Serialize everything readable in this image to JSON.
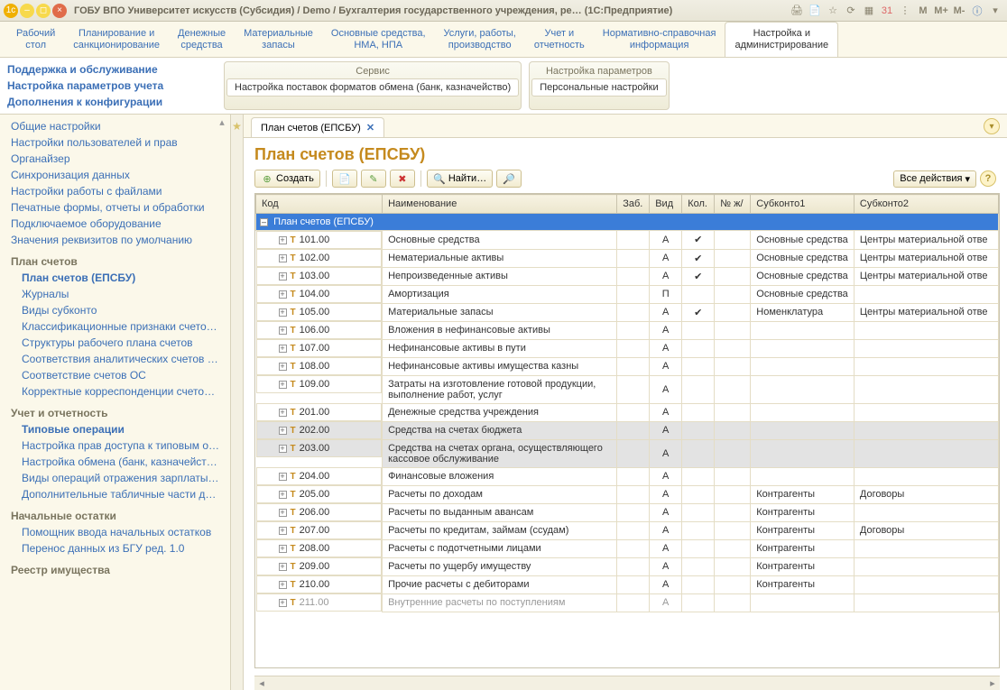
{
  "titlebar": {
    "text": "ГОБУ ВПО Университет искусств (Субсидия) / Demo / Бухгалтерия государственного учреждения, ре…   (1С:Предприятие)",
    "m_buttons": [
      "M",
      "M+",
      "M-"
    ]
  },
  "topnav": [
    {
      "l1": "Рабочий",
      "l2": "стол"
    },
    {
      "l1": "Планирование и",
      "l2": "санкционирование"
    },
    {
      "l1": "Денежные",
      "l2": "средства"
    },
    {
      "l1": "Материальные",
      "l2": "запасы"
    },
    {
      "l1": "Основные средства,",
      "l2": "НМА, НПА"
    },
    {
      "l1": "Услуги, работы,",
      "l2": "производство"
    },
    {
      "l1": "Учет и",
      "l2": "отчетность"
    },
    {
      "l1": "Нормативно-справочная",
      "l2": "информация"
    },
    {
      "l1": "Настройка и",
      "l2": "администрирование",
      "active": true
    }
  ],
  "sidebar_top": [
    "Поддержка и обслуживание",
    "Настройка параметров учета",
    "Дополнения к конфигурации"
  ],
  "ribbon": {
    "g1": {
      "hdr": "Сервис",
      "row": "Настройка поставок форматов обмена (банк, казначейство)"
    },
    "g2": {
      "hdr": "Настройка параметров",
      "row": "Персональные настройки"
    }
  },
  "content_tab": {
    "label": "План счетов (ЕПСБУ)"
  },
  "page_title": "План счетов (ЕПСБУ)",
  "toolbar": {
    "create": "Создать",
    "find": "Найти…",
    "all_actions": "Все действия"
  },
  "sidebar": [
    {
      "type": "link",
      "text": "Общие настройки"
    },
    {
      "type": "link",
      "text": "Настройки пользователей и прав"
    },
    {
      "type": "link",
      "text": "Органайзер"
    },
    {
      "type": "link",
      "text": "Синхронизация данных"
    },
    {
      "type": "link",
      "text": "Настройки работы с файлами"
    },
    {
      "type": "link",
      "text": "Печатные формы, отчеты и обработки"
    },
    {
      "type": "link",
      "text": "Подключаемое оборудование"
    },
    {
      "type": "link",
      "text": "Значения реквизитов по умолчанию"
    },
    {
      "type": "title",
      "text": "План счетов"
    },
    {
      "type": "link",
      "text": "План счетов (ЕПСБУ)",
      "indent": true,
      "bold": true
    },
    {
      "type": "link",
      "text": "Журналы",
      "indent": true
    },
    {
      "type": "link",
      "text": "Виды субконто",
      "indent": true
    },
    {
      "type": "link",
      "text": "Классификационные признаки счето…",
      "indent": true
    },
    {
      "type": "link",
      "text": "Структуры рабочего плана счетов",
      "indent": true
    },
    {
      "type": "link",
      "text": "Соответствия аналитических счетов …",
      "indent": true
    },
    {
      "type": "link",
      "text": "Соответствие счетов ОС",
      "indent": true
    },
    {
      "type": "link",
      "text": "Корректные корреспонденции счетов…",
      "indent": true
    },
    {
      "type": "title",
      "text": "Учет и отчетность"
    },
    {
      "type": "link",
      "text": "Типовые операции",
      "indent": true,
      "bold": true
    },
    {
      "type": "link",
      "text": "Настройка прав доступа к типовым о…",
      "indent": true
    },
    {
      "type": "link",
      "text": "Настройка обмена (банк, казначейст…",
      "indent": true
    },
    {
      "type": "link",
      "text": "Виды операций отражения зарплаты …",
      "indent": true
    },
    {
      "type": "link",
      "text": "Дополнительные табличные части до…",
      "indent": true
    },
    {
      "type": "title",
      "text": "Начальные остатки"
    },
    {
      "type": "link",
      "text": "Помощник ввода начальных остатков",
      "indent": true
    },
    {
      "type": "link",
      "text": "Перенос данных из БГУ ред. 1.0",
      "indent": true
    },
    {
      "type": "title",
      "text": "Реестр имущества"
    }
  ],
  "columns": [
    "Код",
    "Наименование",
    "Заб.",
    "Вид",
    "Кол.",
    "№ ж/",
    "Субконто1",
    "Субконто2"
  ],
  "root_row": "План счетов (ЕПСБУ)",
  "rows": [
    {
      "code": "101.00",
      "name": "Основные средства",
      "vid": "А",
      "kol": "✔",
      "s1": "Основные средства",
      "s2": "Центры материальной отве"
    },
    {
      "code": "102.00",
      "name": "Нематериальные активы",
      "vid": "А",
      "kol": "✔",
      "s1": "Основные средства",
      "s2": "Центры материальной отве"
    },
    {
      "code": "103.00",
      "name": "Непроизведенные активы",
      "vid": "А",
      "kol": "✔",
      "s1": "Основные средства",
      "s2": "Центры материальной отве"
    },
    {
      "code": "104.00",
      "name": "Амортизация",
      "vid": "П",
      "kol": "",
      "s1": "Основные средства",
      "s2": ""
    },
    {
      "code": "105.00",
      "name": "Материальные запасы",
      "vid": "А",
      "kol": "✔",
      "s1": "Номенклатура",
      "s2": "Центры материальной отве"
    },
    {
      "code": "106.00",
      "name": "Вложения в нефинансовые активы",
      "vid": "А",
      "kol": "",
      "s1": "",
      "s2": ""
    },
    {
      "code": "107.00",
      "name": "Нефинансовые активы в пути",
      "vid": "А",
      "kol": "",
      "s1": "",
      "s2": ""
    },
    {
      "code": "108.00",
      "name": "Нефинансовые активы имущества казны",
      "vid": "А",
      "kol": "",
      "s1": "",
      "s2": ""
    },
    {
      "code": "109.00",
      "name": "Затраты на изготовление готовой продукции, выполнение работ, услуг",
      "vid": "А",
      "kol": "",
      "s1": "",
      "s2": ""
    },
    {
      "code": "201.00",
      "name": "Денежные средства учреждения",
      "vid": "А",
      "kol": "",
      "s1": "",
      "s2": ""
    },
    {
      "code": "202.00",
      "name": "Средства на счетах бюджета",
      "vid": "А",
      "kol": "",
      "s1": "",
      "s2": "",
      "gray": true
    },
    {
      "code": "203.00",
      "name": "Средства на счетах органа, осуществляющего кассовое обслуживание",
      "vid": "А",
      "kol": "",
      "s1": "",
      "s2": "",
      "gray": true
    },
    {
      "code": "204.00",
      "name": "Финансовые вложения",
      "vid": "А",
      "kol": "",
      "s1": "",
      "s2": ""
    },
    {
      "code": "205.00",
      "name": "Расчеты по доходам",
      "vid": "А",
      "kol": "",
      "s1": "Контрагенты",
      "s2": "Договоры"
    },
    {
      "code": "206.00",
      "name": "Расчеты по выданным авансам",
      "vid": "А",
      "kol": "",
      "s1": "Контрагенты",
      "s2": ""
    },
    {
      "code": "207.00",
      "name": "Расчеты по кредитам, займам (ссудам)",
      "vid": "А",
      "kol": "",
      "s1": "Контрагенты",
      "s2": "Договоры"
    },
    {
      "code": "208.00",
      "name": "Расчеты с подотчетными лицами",
      "vid": "А",
      "kol": "",
      "s1": "Контрагенты",
      "s2": ""
    },
    {
      "code": "209.00",
      "name": "Расчеты по ущербу имуществу",
      "vid": "А",
      "kol": "",
      "s1": "Контрагенты",
      "s2": ""
    },
    {
      "code": "210.00",
      "name": "Прочие расчеты с дебиторами",
      "vid": "А",
      "kol": "",
      "s1": "Контрагенты",
      "s2": ""
    },
    {
      "code": "211.00",
      "name": "Внутренние расчеты по поступлениям",
      "vid": "А",
      "kol": "",
      "s1": "",
      "s2": "",
      "partial": true
    }
  ]
}
